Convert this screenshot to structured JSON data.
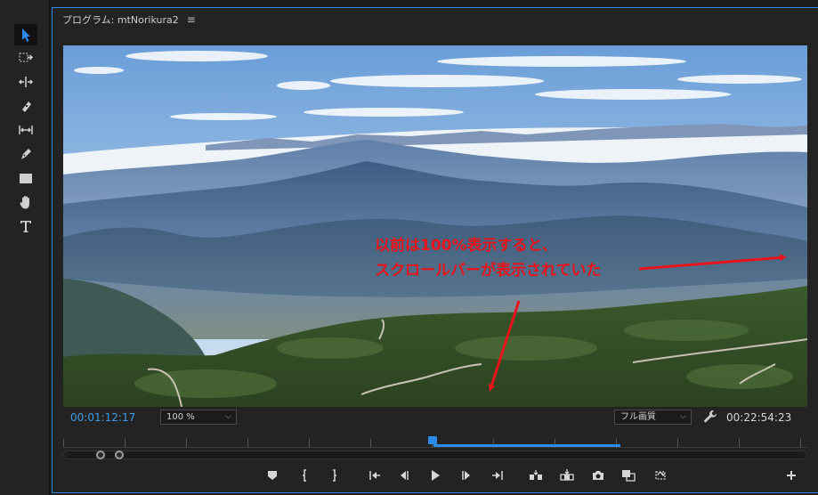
{
  "toolbar": {
    "tools": [
      "selection",
      "track-select",
      "ripple-edit",
      "razor",
      "slip",
      "pen",
      "rectangle",
      "hand",
      "type"
    ],
    "active_tool": "selection"
  },
  "panel": {
    "title": "プログラム: mtNorikura2",
    "menu_icon": "hamburger-menu-icon"
  },
  "viewer": {
    "annotation_line1": "以前は100%表示すると、",
    "annotation_line2": "スクロールバーが表示されていた",
    "annotation_color": "#e8141b"
  },
  "controls": {
    "current_timecode": "00:01:12:17",
    "zoom_level": "100 %",
    "playback_resolution": "フル画質",
    "duration_timecode": "00:22:54:23"
  },
  "colors": {
    "accent": "#2d8ceb",
    "panel_bg": "#232323"
  }
}
